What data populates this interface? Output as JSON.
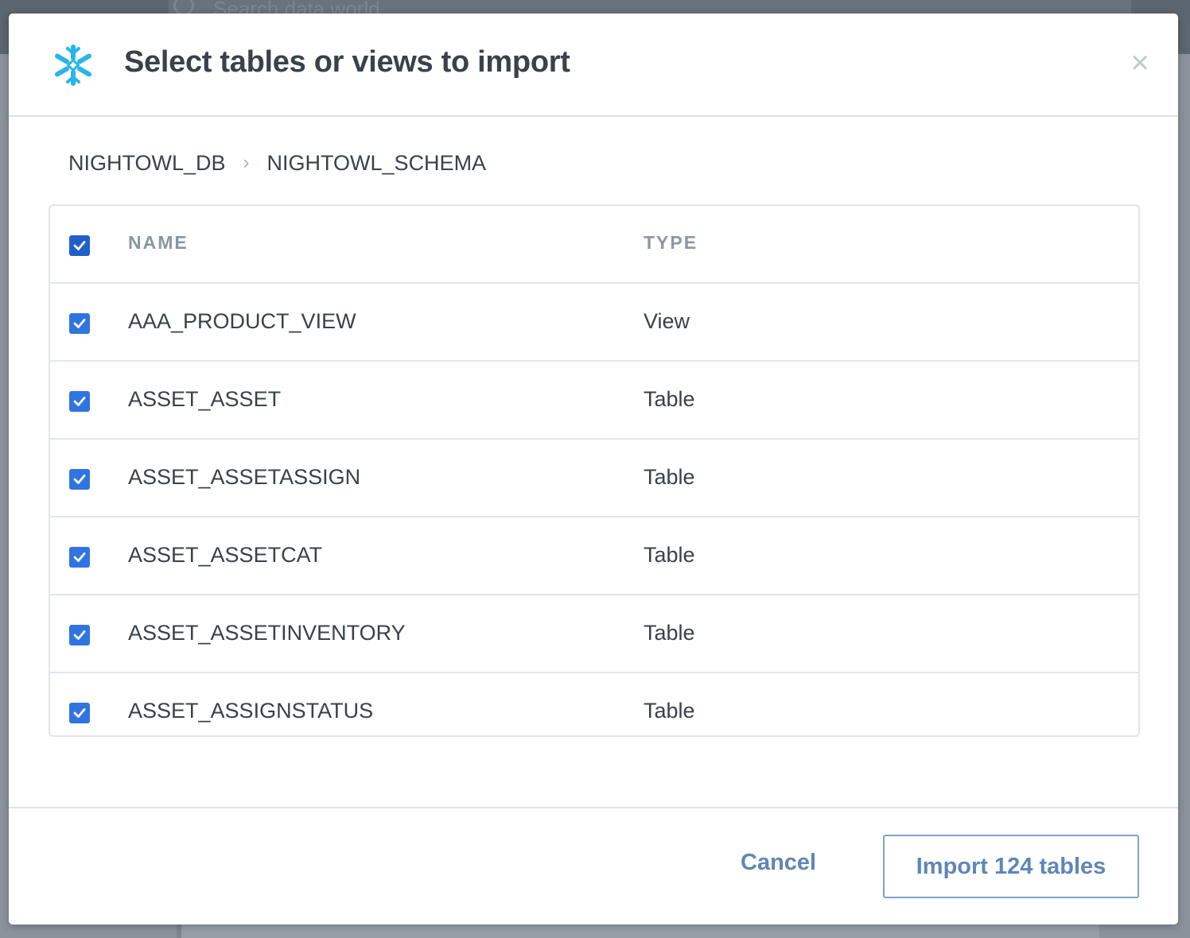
{
  "background": {
    "search_placeholder": "Search data.world"
  },
  "modal": {
    "title": "Select tables or views to import",
    "close_symbol": "×",
    "logo_icon": "snowflake-icon",
    "accent_color": "#29b5e8"
  },
  "breadcrumb": {
    "items": [
      "NIGHTOWL_DB",
      "NIGHTOWL_SCHEMA"
    ],
    "separator": "›"
  },
  "table": {
    "columns": [
      "NAME",
      "TYPE"
    ],
    "select_all_checked": true,
    "rows": [
      {
        "name": "AAA_PRODUCT_VIEW",
        "type": "View",
        "checked": true
      },
      {
        "name": "ASSET_ASSET",
        "type": "Table",
        "checked": true
      },
      {
        "name": "ASSET_ASSETASSIGN",
        "type": "Table",
        "checked": true
      },
      {
        "name": "ASSET_ASSETCAT",
        "type": "Table",
        "checked": true
      },
      {
        "name": "ASSET_ASSETINVENTORY",
        "type": "Table",
        "checked": true
      },
      {
        "name": "ASSET_ASSIGNSTATUS",
        "type": "Table",
        "checked": true
      }
    ]
  },
  "footer": {
    "cancel_label": "Cancel",
    "import_label": "Import 124 tables"
  },
  "colors": {
    "checkbox": "#2f74e0",
    "button_text": "#5f86b8",
    "text": "#3a4149"
  }
}
